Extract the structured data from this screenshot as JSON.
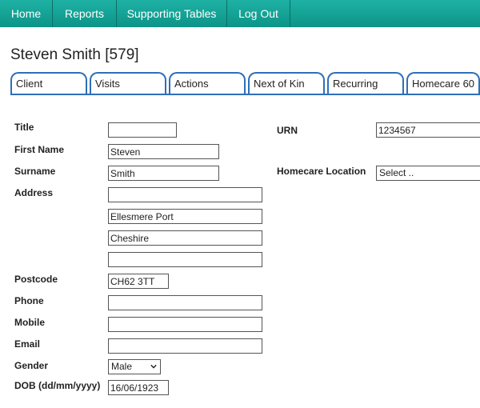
{
  "nav": {
    "items": [
      "Home",
      "Reports",
      "Supporting Tables",
      "Log Out"
    ]
  },
  "page": {
    "title": "Steven Smith [579]"
  },
  "tabs": [
    "Client",
    "Visits",
    "Actions",
    "Next of Kin",
    "Recurring",
    "Homecare 60"
  ],
  "form": {
    "title_label": "Title",
    "title_value": "",
    "first_name_label": "First Name",
    "first_name_value": "Steven",
    "surname_label": "Surname",
    "surname_value": "Smith",
    "address_label": "Address",
    "address_lines": [
      "",
      "Ellesmere Port",
      "Cheshire",
      ""
    ],
    "postcode_label": "Postcode",
    "postcode_value": "CH62 3TT",
    "phone_label": "Phone",
    "phone_value": "",
    "mobile_label": "Mobile",
    "mobile_value": "",
    "email_label": "Email",
    "email_value": "",
    "gender_label": "Gender",
    "gender_value": "Male",
    "dob_label": "DOB (dd/mm/yyyy)",
    "dob_value": "16/06/1923",
    "urn_label": "URN",
    "urn_value": "1234567",
    "homecare_location_label": "Homecare Location",
    "homecare_location_value": "Select .."
  },
  "icons": {
    "dropdown": "chevron-down-icon"
  },
  "colors": {
    "nav_bg": "#1aa89c",
    "tab_border": "#2f6fb8"
  }
}
